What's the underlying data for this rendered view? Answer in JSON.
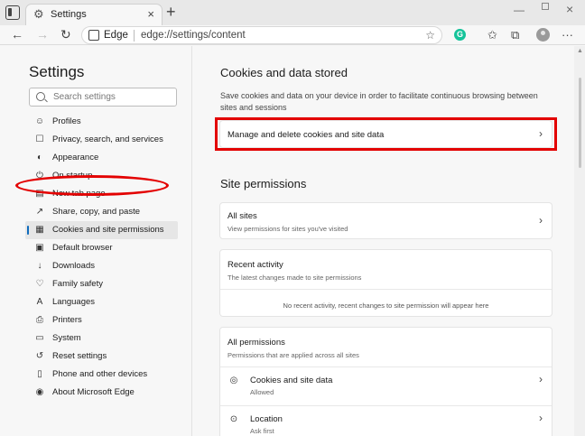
{
  "browser": {
    "tab_title": "Settings",
    "close_glyph": "×",
    "new_tab_glyph": "+",
    "address_brand": "Edge",
    "url": "edge://settings/content"
  },
  "sidebar": {
    "title": "Settings",
    "search_placeholder": "Search settings",
    "items": [
      {
        "label": "Profiles",
        "icon": "profile-icon",
        "glyph": "☺"
      },
      {
        "label": "Privacy, search, and services",
        "icon": "lock-icon",
        "glyph": "☐"
      },
      {
        "label": "Appearance",
        "icon": "appearance-icon",
        "glyph": "◐"
      },
      {
        "label": "On startup",
        "icon": "power-icon",
        "glyph": "⏻"
      },
      {
        "label": "New tab page",
        "icon": "new-tab-page-icon",
        "glyph": "▤"
      },
      {
        "label": "Share, copy, and paste",
        "icon": "share-icon",
        "glyph": "↗"
      },
      {
        "label": "Cookies and site permissions",
        "icon": "cookie-permissions-icon",
        "glyph": "▦",
        "active": true
      },
      {
        "label": "Default browser",
        "icon": "browser-icon",
        "glyph": "▣"
      },
      {
        "label": "Downloads",
        "icon": "download-icon",
        "glyph": "↓"
      },
      {
        "label": "Family safety",
        "icon": "family-icon",
        "glyph": "♡"
      },
      {
        "label": "Languages",
        "icon": "languages-icon",
        "glyph": "A"
      },
      {
        "label": "Printers",
        "icon": "printer-icon",
        "glyph": "⎙"
      },
      {
        "label": "System",
        "icon": "system-icon",
        "glyph": "▭"
      },
      {
        "label": "Reset settings",
        "icon": "reset-icon",
        "glyph": "↺"
      },
      {
        "label": "Phone and other devices",
        "icon": "phone-icon",
        "glyph": "▯"
      },
      {
        "label": "About Microsoft Edge",
        "icon": "edge-logo-icon",
        "glyph": "◉"
      }
    ]
  },
  "main": {
    "cookies_heading": "Cookies and data stored",
    "cookies_desc": "Save cookies and data on your device in order to facilitate continuous browsing between sites and sessions",
    "manage_label": "Manage and delete cookies and site data",
    "site_permissions_heading": "Site permissions",
    "all_sites_title": "All sites",
    "all_sites_sub": "View permissions for sites you've visited",
    "recent_title": "Recent activity",
    "recent_sub": "The latest changes made to site permissions",
    "recent_empty": "No recent activity, recent changes to site permission will appear here",
    "all_perms_title": "All permissions",
    "all_perms_sub": "Permissions that are applied across all sites",
    "perm_rows": [
      {
        "title": "Cookies and site data",
        "sub": "Allowed",
        "icon": "cookie-icon",
        "glyph": "◎"
      },
      {
        "title": "Location",
        "sub": "Ask first",
        "icon": "location-icon",
        "glyph": "⊙"
      }
    ]
  },
  "colors": {
    "highlight": "#e30000",
    "active_accent": "#0f6cbd"
  }
}
